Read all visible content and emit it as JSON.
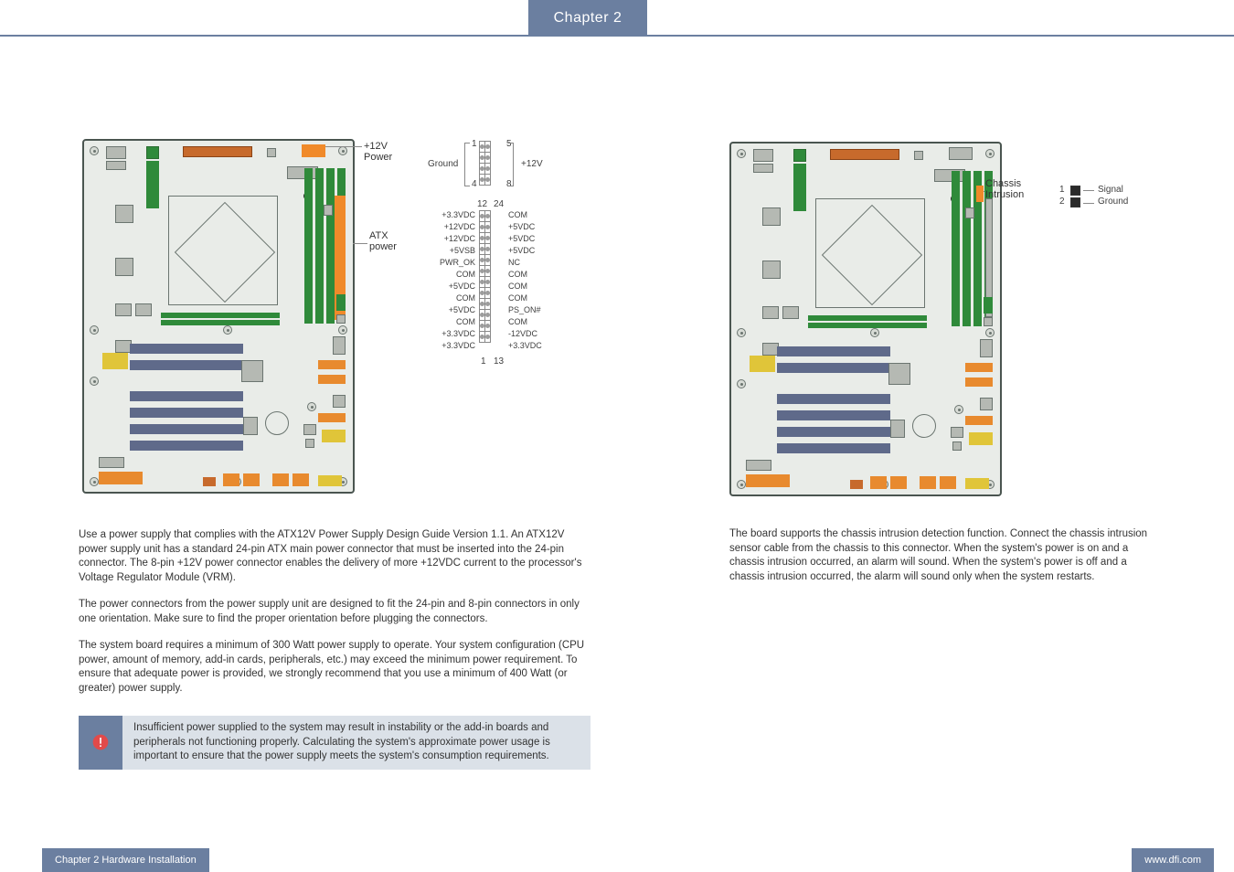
{
  "header": {
    "chapter": "Chapter 2"
  },
  "footer": {
    "left": "Chapter 2 Hardware Installation",
    "right": "www.dfi.com"
  },
  "left": {
    "labels": {
      "p12v": "+12V\nPower",
      "atx": "ATX\npower",
      "ground": "Ground",
      "p12v_r": "+12V",
      "pin8": {
        "tl": "1",
        "tr": "5",
        "bl": "4",
        "br": "8"
      },
      "pin24": {
        "top_l": "12",
        "top_r": "24",
        "bot_l": "1",
        "bot_r": "13",
        "left": [
          "+3.3VDC",
          "+12VDC",
          "+12VDC",
          "+5VSB",
          "PWR_OK",
          "COM",
          "+5VDC",
          "COM",
          "+5VDC",
          "COM",
          "+3.3VDC",
          "+3.3VDC"
        ],
        "right": [
          "COM",
          "+5VDC",
          "+5VDC",
          "+5VDC",
          "NC",
          "COM",
          "COM",
          "COM",
          "PS_ON#",
          "COM",
          "-12VDC",
          "+3.3VDC"
        ]
      }
    },
    "p1": "Use a power supply that complies with the ATX12V Power Supply Design Guide Version 1.1. An ATX12V power supply unit has a standard 24-pin ATX main power connector that must be inserted into the 24-pin connector. The 8-pin +12V power connector enables the delivery of more +12VDC current to the processor's Voltage Regulator Module (VRM).",
    "p2": "The power connectors from the power supply unit are designed to fit the 24-pin and 8-pin connectors in only one orientation. Make sure to find the proper orientation before plugging the connectors.",
    "p3": "The system board requires a minimum of 300 Watt power supply to operate. Your system configuration (CPU power, amount of memory, add-in cards, peripherals, etc.) may exceed the minimum power requirement. To ensure that adequate power is provided, we strongly recommend that you use a minimum of 400 Watt (or greater) power supply.",
    "important": "Insufficient power supplied to the system may result in instability or the add-in boards and peripherals not functioning properly. Calculating the system's approximate power usage is important to ensure that the power supply meets the system's consumption requirements."
  },
  "right": {
    "labels": {
      "chassis": "Chassis\nIntrusion",
      "signal": "Signal",
      "ground": "Ground",
      "n1": "1",
      "n2": "2"
    },
    "p1": "The board supports the chassis intrusion detection function. Connect the chassis intrusion sensor cable from the chassis to this connector. When the system's power is on and a chassis intrusion occurred, an alarm will sound. When the system's power is off and a chassis intrusion occurred, the alarm will sound only when the system restarts."
  },
  "icons": {
    "warn": "warning-icon"
  }
}
